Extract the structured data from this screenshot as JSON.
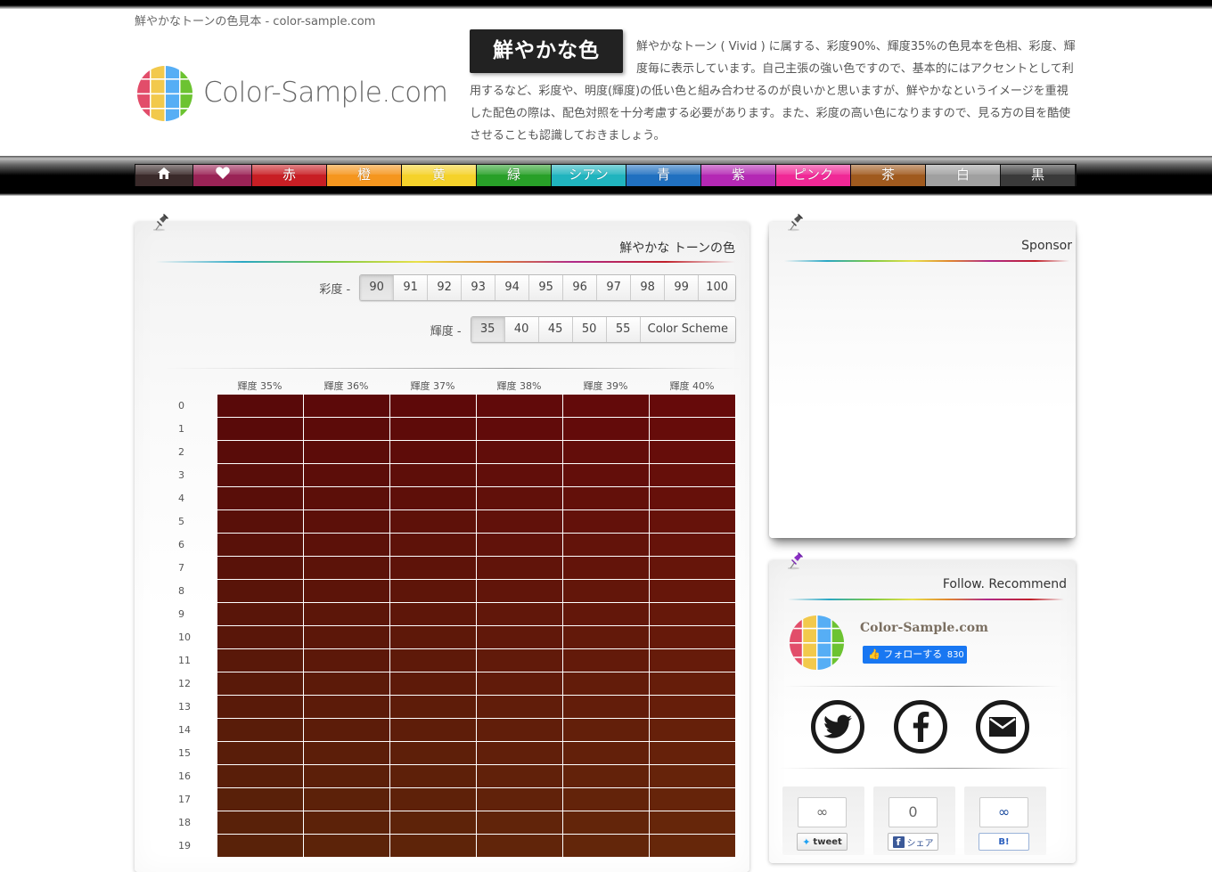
{
  "header": {
    "tagline": "鮮やかなトーンの色見本 - color-sample.com",
    "logo_text": "Color-Sample.com",
    "logo_icon": "color-grid-logo-icon",
    "hero_badge": "鮮やかな色",
    "hero_description": "鮮やかなトーン ( Vivid ) に属する、彩度90%、輝度35%の色見本を色相、彩度、輝度毎に表示しています。自己主張の強い色ですので、基本的にはアクセントとして利用するなど、彩度や、明度(輝度)の低い色と組み合わせるのが良いかと思いますが、鮮やかなというイメージを重視した配色の際は、配色対照を十分考慮する必要があります。また、彩度の高い色になりますので、見る方の目を酷使させることも認識しておきましょう。"
  },
  "nav": {
    "items": [
      {
        "label": "",
        "icon": "home-icon",
        "color": "#3a2a2a"
      },
      {
        "label": "",
        "icon": "heart-icon",
        "color": "#9a2356"
      },
      {
        "label": "赤",
        "color": "#c81e24"
      },
      {
        "label": "橙",
        "color": "#f5961e"
      },
      {
        "label": "黄",
        "color": "#f5d22a"
      },
      {
        "label": "緑",
        "color": "#28a028"
      },
      {
        "label": "シアン",
        "color": "#20b4be"
      },
      {
        "label": "青",
        "color": "#2070c0"
      },
      {
        "label": "紫",
        "color": "#b428b4"
      },
      {
        "label": "ピンク",
        "color": "#f02896"
      },
      {
        "label": "茶",
        "color": "#a05a1e"
      },
      {
        "label": "白",
        "color": "#a0a0a0"
      },
      {
        "label": "黒",
        "color": "#3a3a3a"
      }
    ]
  },
  "main_card": {
    "title": "鮮やかな トーンの色",
    "saturation": {
      "label": "彩度 -",
      "options": [
        "90",
        "91",
        "92",
        "93",
        "94",
        "95",
        "96",
        "97",
        "98",
        "99",
        "100"
      ],
      "selected": "90"
    },
    "brightness": {
      "label": "輝度 -",
      "options": [
        "35",
        "40",
        "45",
        "50",
        "55",
        "Color Scheme"
      ],
      "selected": "35"
    },
    "table": {
      "saturation_percent": 90,
      "column_headers": [
        "輝度 35%",
        "輝度 36%",
        "輝度 37%",
        "輝度 38%",
        "輝度 39%",
        "輝度 40%"
      ],
      "brightness_values": [
        35,
        36,
        37,
        38,
        39,
        40
      ],
      "hue_rows": [
        0,
        1,
        2,
        3,
        4,
        5,
        6,
        7,
        8,
        9,
        10,
        11,
        12,
        13,
        14,
        15,
        16,
        17,
        18,
        19
      ]
    }
  },
  "sponsor_card": {
    "title": "Sponsor"
  },
  "follow_card": {
    "title": "Follow. Recommend",
    "site_name": "Color-Sample.com",
    "fb_follow_label": "フォローする",
    "fb_follow_count": "830",
    "social_icons": [
      "twitter-icon",
      "facebook-icon",
      "mail-icon"
    ],
    "share": [
      {
        "count": "∞",
        "button_label": "tweet",
        "icon": "twitter-icon"
      },
      {
        "count": "0",
        "button_label": "シェア",
        "icon": "facebook-icon"
      },
      {
        "count": "∞",
        "button_label": "B!",
        "icon": "hatena-bookmark-icon"
      }
    ]
  }
}
